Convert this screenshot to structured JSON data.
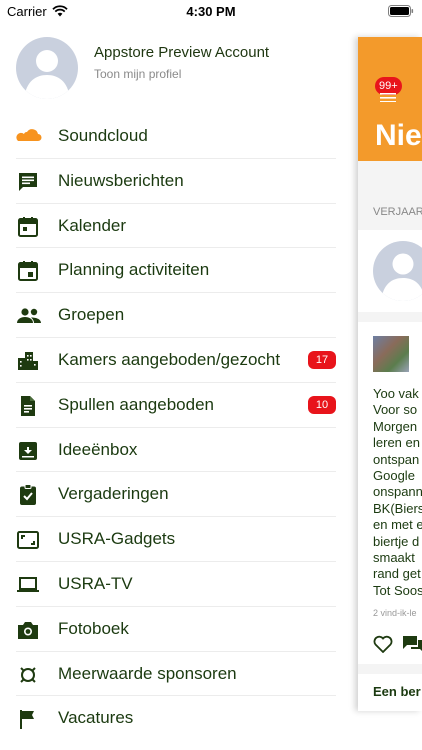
{
  "status_bar": {
    "carrier": "Carrier",
    "time": "4:30 PM"
  },
  "profile": {
    "name": "Appstore Preview Account",
    "subtitle": "Toon mijn profiel"
  },
  "menu": [
    {
      "label": "Soundcloud",
      "icon": "soundcloud-icon"
    },
    {
      "label": "Nieuwsberichten",
      "icon": "chat-bubble-icon"
    },
    {
      "label": "Kalender",
      "icon": "calendar-icon"
    },
    {
      "label": "Planning activiteiten",
      "icon": "calendar-event-icon"
    },
    {
      "label": "Groepen",
      "icon": "people-icon"
    },
    {
      "label": "Kamers aangeboden/gezocht",
      "icon": "buildings-icon",
      "badge": "17"
    },
    {
      "label": "Spullen aangeboden",
      "icon": "document-icon",
      "badge": "10"
    },
    {
      "label": "Ideeënbox",
      "icon": "archive-box-icon"
    },
    {
      "label": "Vergaderingen",
      "icon": "clipboard-check-icon"
    },
    {
      "label": "USRA-Gadgets",
      "icon": "aspect-frame-icon"
    },
    {
      "label": "USRA-TV",
      "icon": "laptop-icon"
    },
    {
      "label": "Fotoboek",
      "icon": "camera-icon"
    },
    {
      "label": "Meerwaarde sponsoren",
      "icon": "watch-icon"
    },
    {
      "label": "Vacatures",
      "icon": "flag-icon"
    }
  ],
  "main_peek": {
    "badge": "99+",
    "title": "Nie",
    "section_label": "VERJAAR",
    "post_text": "Yoo vak\nVoor so\nMorgen\nleren en\nontspan\nGoogle\nonspann\nBK(Biers\nen met e\nbiertje d\nsmaakt\nrand get\nTot Soos",
    "likes": "2 vind-ik-le",
    "footer": "Een ber"
  },
  "colors": {
    "accent": "#f39a2b",
    "badge": "#e8141b",
    "text": "#1b3a10",
    "icon": "#1e3a10"
  }
}
